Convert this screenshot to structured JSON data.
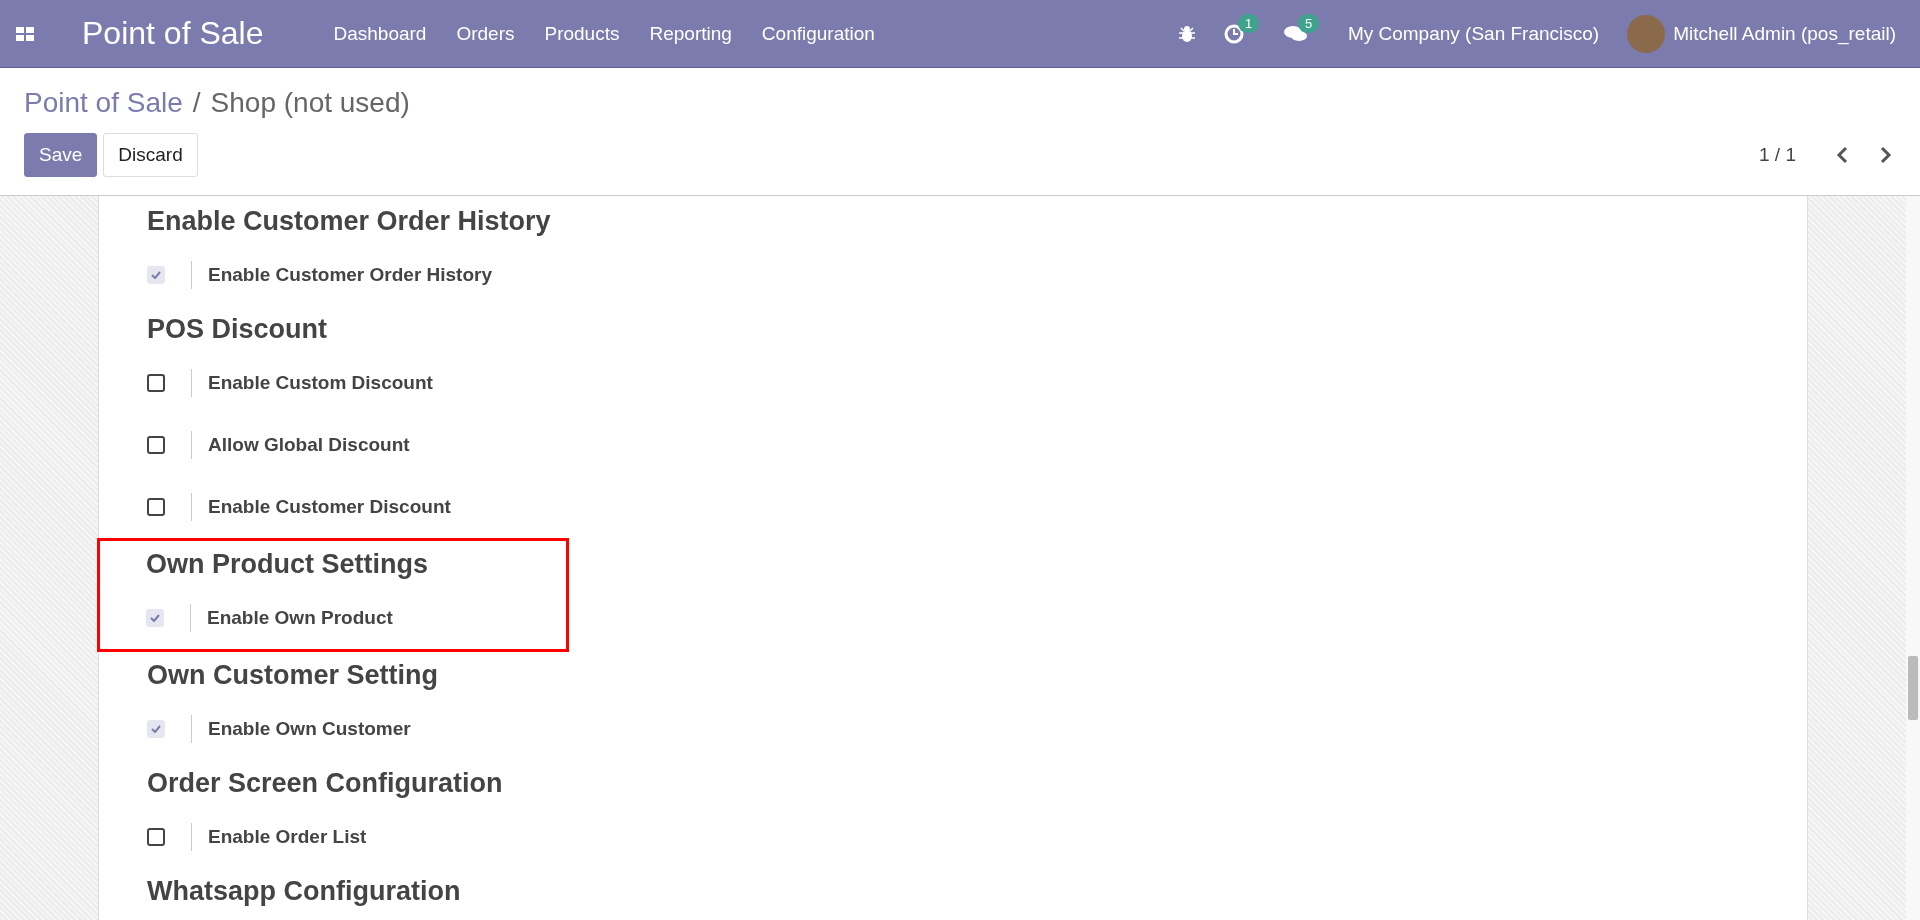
{
  "navbar": {
    "app_title": "Point of Sale",
    "menu": [
      "Dashboard",
      "Orders",
      "Products",
      "Reporting",
      "Configuration"
    ],
    "activity_count": "1",
    "message_count": "5",
    "company": "My Company (San Francisco)",
    "user": "Mitchell Admin (pos_retail)"
  },
  "breadcrumb": {
    "parent": "Point of Sale",
    "separator": "/",
    "current": "Shop (not used)"
  },
  "buttons": {
    "save": "Save",
    "discard": "Discard"
  },
  "pager": "1 / 1",
  "sections": [
    {
      "title": "Enable Customer Order History",
      "highlighted": false,
      "options": [
        {
          "label": "Enable Customer Order History",
          "checked": true
        }
      ]
    },
    {
      "title": "POS Discount",
      "highlighted": false,
      "options": [
        {
          "label": "Enable Custom Discount",
          "checked": false
        },
        {
          "label": "Allow Global Discount",
          "checked": false
        },
        {
          "label": "Enable Customer Discount",
          "checked": false
        }
      ]
    },
    {
      "title": "Own Product Settings",
      "highlighted": true,
      "options": [
        {
          "label": "Enable Own Product",
          "checked": true
        }
      ]
    },
    {
      "title": "Own Customer Setting",
      "highlighted": false,
      "options": [
        {
          "label": "Enable Own Customer",
          "checked": true
        }
      ]
    },
    {
      "title": "Order Screen Configuration",
      "highlighted": false,
      "options": [
        {
          "label": "Enable Order List",
          "checked": false
        }
      ]
    },
    {
      "title": "Whatsapp Configuration",
      "highlighted": false
    }
  ]
}
